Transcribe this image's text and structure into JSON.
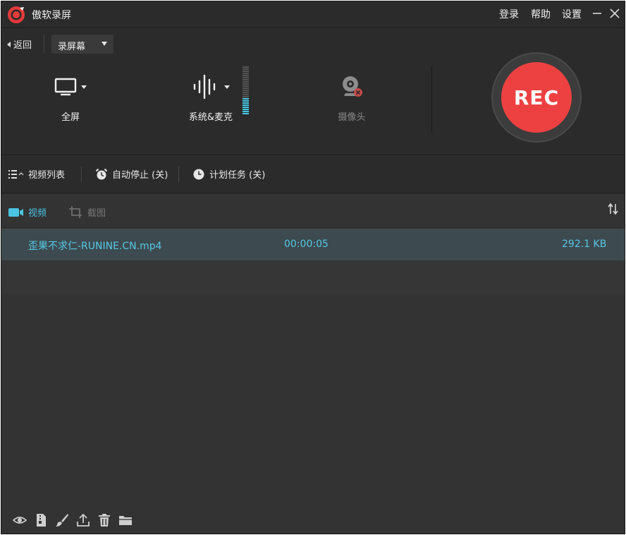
{
  "app": {
    "title": "傲软录屏"
  },
  "titlebar": {
    "login_label": "登录",
    "help_label": "帮助",
    "settings_label": "设置"
  },
  "controls": {
    "back_label": "返回",
    "mode_selected": "录屏幕",
    "sources": [
      {
        "label": "全屏",
        "icon": "monitor-icon"
      },
      {
        "label": "系统&麦克",
        "icon": "audio-wave-icon"
      },
      {
        "label": "摄像头",
        "icon": "webcam-icon",
        "disabled": true
      }
    ],
    "rec_label": "REC",
    "rec_color": "#ed4141"
  },
  "toolbar": {
    "video_list_label": "视频列表",
    "auto_stop_label": "自动停止 (关)",
    "schedule_label": "计划任务 (关)"
  },
  "list": {
    "tab_video_label": "视频",
    "tab_screenshot_label": "截图",
    "accent_color": "#4bc4e3",
    "files": [
      {
        "name": "歪果不求仁-RUNINE.CN.mp4",
        "duration": "00:00:05",
        "size": "292.1 KB"
      }
    ]
  },
  "bottom_icons": [
    "eye-icon",
    "file-zip-icon",
    "brush-icon",
    "upload-icon",
    "trash-icon",
    "folder-icon"
  ]
}
